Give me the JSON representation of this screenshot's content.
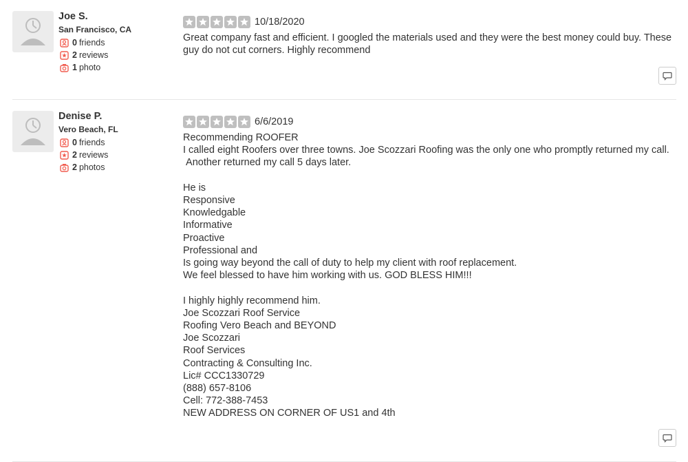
{
  "colors": {
    "accent": "#f15c4f",
    "star_gray": "#bfbfbf",
    "text": "#333333",
    "divider": "#e6e6e6"
  },
  "reviews": [
    {
      "user": {
        "name": "Joe S.",
        "location": "San Francisco, CA",
        "friends_count": "0",
        "friends_label": "friends",
        "reviews_count": "2",
        "reviews_label": "reviews",
        "photos_count": "1",
        "photos_label": "photo",
        "avatar_icon": "default-user-avatar"
      },
      "rating": 5,
      "date": "10/18/2020",
      "text": "Great company fast and efficient. I googled the materials used and they were the best money could buy. These guy do not cut corners. Highly recommend",
      "comment_icon": "speech-bubble-icon"
    },
    {
      "user": {
        "name": "Denise P.",
        "location": "Vero Beach, FL",
        "friends_count": "0",
        "friends_label": "friends",
        "reviews_count": "2",
        "reviews_label": "reviews",
        "photos_count": "2",
        "photos_label": "photos",
        "avatar_icon": "default-user-avatar"
      },
      "rating": 5,
      "date": "6/6/2019",
      "text": "Recommending ROOFER\nI called eight Roofers over three towns. Joe Scozzari Roofing was the only one who promptly returned my call.\n Another returned my call 5 days later.\n\nHe is\nResponsive\nKnowledgable\nInformative\nProactive\nProfessional and\nIs going way beyond the call of duty to help my client with roof replacement.\nWe feel blessed to have him working with us. GOD BLESS HIM!!!\n\nI highly highly recommend him.\nJoe Scozzari Roof Service\nRoofing Vero Beach and BEYOND\nJoe Scozzari\nRoof Services\nContracting & Consulting Inc.\nLic# CCC1330729\n(888) 657-8106\nCell: 772-388-7453\nNEW ADDRESS ON CORNER OF US1 and 4th",
      "comment_icon": "speech-bubble-icon"
    }
  ]
}
